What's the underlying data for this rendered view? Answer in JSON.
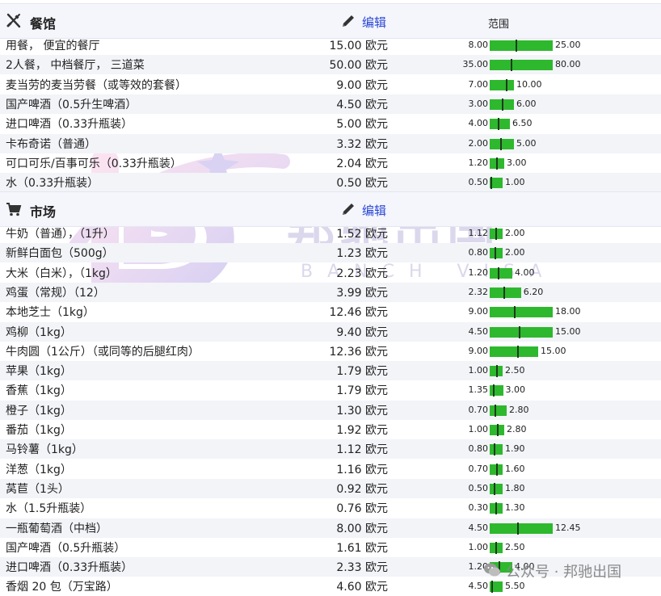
{
  "restaurants": {
    "title": "餐馆",
    "edit_label": "编辑",
    "range_label": "范围",
    "rows": [
      {
        "name": "用餐， 便宜的餐厅",
        "price": "15.00 欧元",
        "min": "8.00",
        "max": "25.00"
      },
      {
        "name": "2人餐， 中档餐厅， 三道菜",
        "price": "50.00 欧元",
        "min": "35.00",
        "max": "80.00"
      },
      {
        "name": "麦当劳的麦当劳餐（或等效的套餐）",
        "price": "9.00 欧元",
        "min": "7.00",
        "max": "10.00"
      },
      {
        "name": "国产啤酒（0.5升生啤酒）",
        "price": "4.50 欧元",
        "min": "3.00",
        "max": "6.00"
      },
      {
        "name": "进口啤酒（0.33升瓶装）",
        "price": "5.00 欧元",
        "min": "4.00",
        "max": "6.50"
      },
      {
        "name": "卡布奇诺（普通）",
        "price": "3.32 欧元",
        "min": "2.00",
        "max": "5.00"
      },
      {
        "name": "可口可乐/百事可乐（0.33升瓶装）",
        "price": "2.04 欧元",
        "min": "1.20",
        "max": "3.00"
      },
      {
        "name": "水（0.33升瓶装）",
        "price": "0.50 欧元",
        "min": "0.50",
        "max": "1.00"
      }
    ]
  },
  "markets": {
    "title": "市场",
    "edit_label": "编辑",
    "rows": [
      {
        "name": "牛奶（普通），（1升）",
        "price": "1.52 欧元",
        "min": "1.12",
        "max": "2.00"
      },
      {
        "name": "新鲜白面包（500g）",
        "price": "1.23 欧元",
        "min": "0.80",
        "max": "2.00"
      },
      {
        "name": "大米（白米），（1kg）",
        "price": "2.23 欧元",
        "min": "1.20",
        "max": "4.00"
      },
      {
        "name": "鸡蛋（常规）（12）",
        "price": "3.99 欧元",
        "min": "2.32",
        "max": "6.20"
      },
      {
        "name": "本地芝士（1kg）",
        "price": "12.46 欧元",
        "min": "9.00",
        "max": "18.00"
      },
      {
        "name": "鸡柳（1kg）",
        "price": "9.40 欧元",
        "min": "4.50",
        "max": "15.00"
      },
      {
        "name": "牛肉圆（1公斤）（或同等的后腿红肉）",
        "price": "12.36 欧元",
        "min": "9.00",
        "max": "15.00"
      },
      {
        "name": "苹果（1kg）",
        "price": "1.79 欧元",
        "min": "1.00",
        "max": "2.50"
      },
      {
        "name": "香蕉（1kg）",
        "price": "1.79 欧元",
        "min": "1.35",
        "max": "3.00"
      },
      {
        "name": "橙子（1kg）",
        "price": "1.30 欧元",
        "min": "0.70",
        "max": "2.80"
      },
      {
        "name": "番茄（1kg）",
        "price": "1.92 欧元",
        "min": "1.00",
        "max": "2.80"
      },
      {
        "name": "马铃薯（1kg）",
        "price": "1.12 欧元",
        "min": "0.80",
        "max": "1.90"
      },
      {
        "name": "洋葱（1kg）",
        "price": "1.16 欧元",
        "min": "0.70",
        "max": "1.60"
      },
      {
        "name": "莴苣（1头）",
        "price": "0.92 欧元",
        "min": "0.50",
        "max": "1.80"
      },
      {
        "name": "水（1.5升瓶装）",
        "price": "0.76 欧元",
        "min": "0.30",
        "max": "1.30"
      },
      {
        "name": "一瓶葡萄酒（中档）",
        "price": "8.00 欧元",
        "min": "4.50",
        "max": "12.45"
      },
      {
        "name": "国产啤酒（0.5升瓶装）",
        "price": "1.61 欧元",
        "min": "1.00",
        "max": "2.50"
      },
      {
        "name": "进口啤酒（0.33升瓶装）",
        "price": "2.33 欧元",
        "min": "1.20",
        "max": "4.00"
      },
      {
        "name": "香烟 20 包（万宝路）",
        "price": "4.60 欧元",
        "min": "4.50",
        "max": "5.50"
      }
    ]
  },
  "watermark": {
    "brand": "邦驰出国",
    "brand_en": "BANCH VISA",
    "wechat": "公众号 · 邦驰出国"
  },
  "colors": {
    "bar": "#2eb82e",
    "tick": "#1d3a1d",
    "link": "#2b47d6",
    "header_bg": "#f4f6fb",
    "row_alt": "#f2f4f8"
  }
}
